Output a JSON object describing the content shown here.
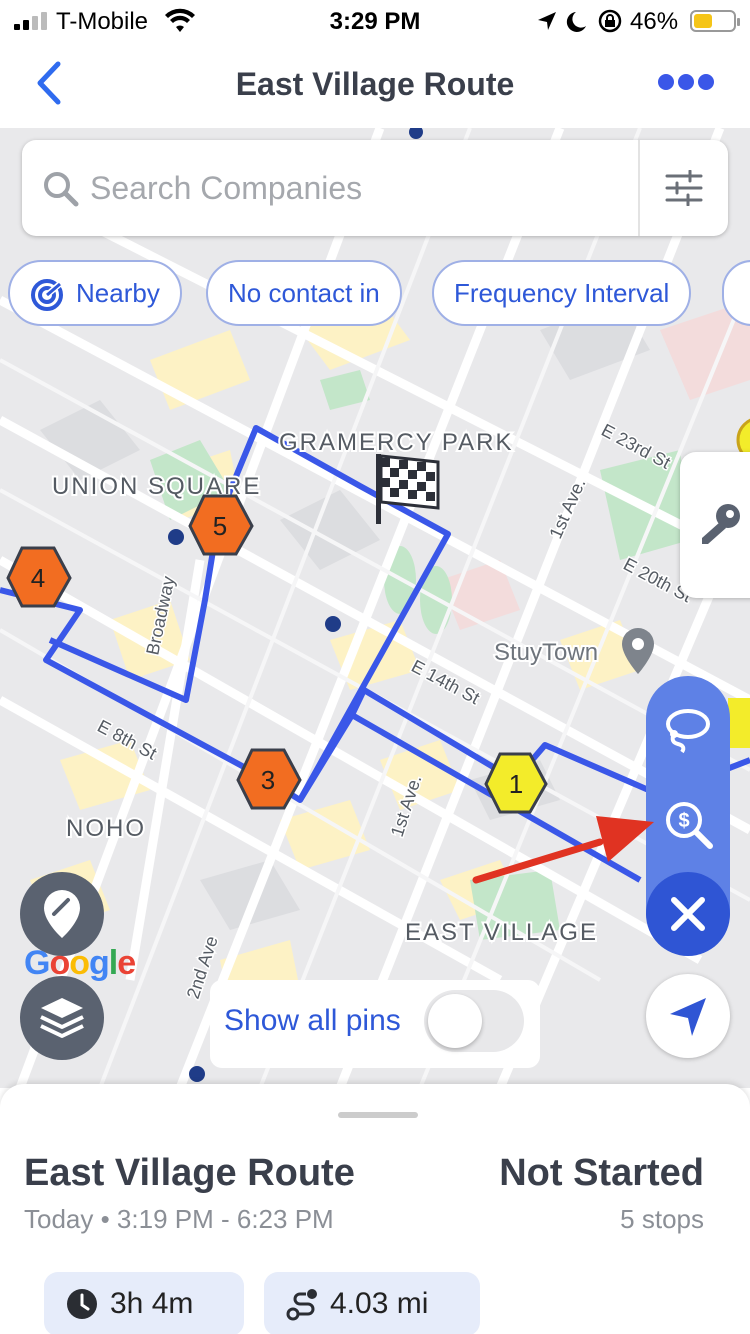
{
  "status_bar": {
    "carrier": "T-Mobile",
    "time": "3:29 PM",
    "battery_percent": "46%",
    "battery_color": "#f5c518"
  },
  "nav": {
    "title": "East Village Route",
    "back_icon": "chevron-left-icon",
    "more_icon": "ellipsis-icon"
  },
  "search": {
    "placeholder": "Search Companies",
    "filter_icon": "sliders-icon"
  },
  "chips": [
    {
      "label": "Nearby",
      "icon": "nearby-icon"
    },
    {
      "label": "No contact in"
    },
    {
      "label": "Frequency Interval"
    }
  ],
  "map": {
    "labels": {
      "gramercy": "GRAMERCY PARK",
      "union_square": "UNION SQUARE",
      "noho": "NOHO",
      "east_village": "EAST VILLAGE",
      "stuytown": "StuyTown",
      "e23": "E 23rd St",
      "e20": "E 20th St",
      "e14": "E 14th St",
      "e8": "E 8th St",
      "first_ave_top": "1st Ave.",
      "first_ave_bottom": "1st Ave.",
      "broadway": "Broadway",
      "second_ave": "2nd Ave"
    },
    "stops": [
      {
        "label": "1",
        "color": "#f3ec2a"
      },
      {
        "label": "3",
        "color": "#f26d21"
      },
      {
        "label": "4",
        "color": "#f26d21"
      },
      {
        "label": "5",
        "color": "#f26d21"
      }
    ],
    "route_color": "#3a57e8",
    "google_logo": "Google"
  },
  "controls": {
    "show_all_pins": "Show all pins",
    "show_all_pins_on": false
  },
  "route_summary": {
    "title": "East Village Route",
    "schedule": "Today • 3:19 PM - 6:23 PM",
    "status": "Not Started",
    "stops": "5 stops",
    "duration": "3h 4m",
    "distance": "4.03 mi"
  }
}
